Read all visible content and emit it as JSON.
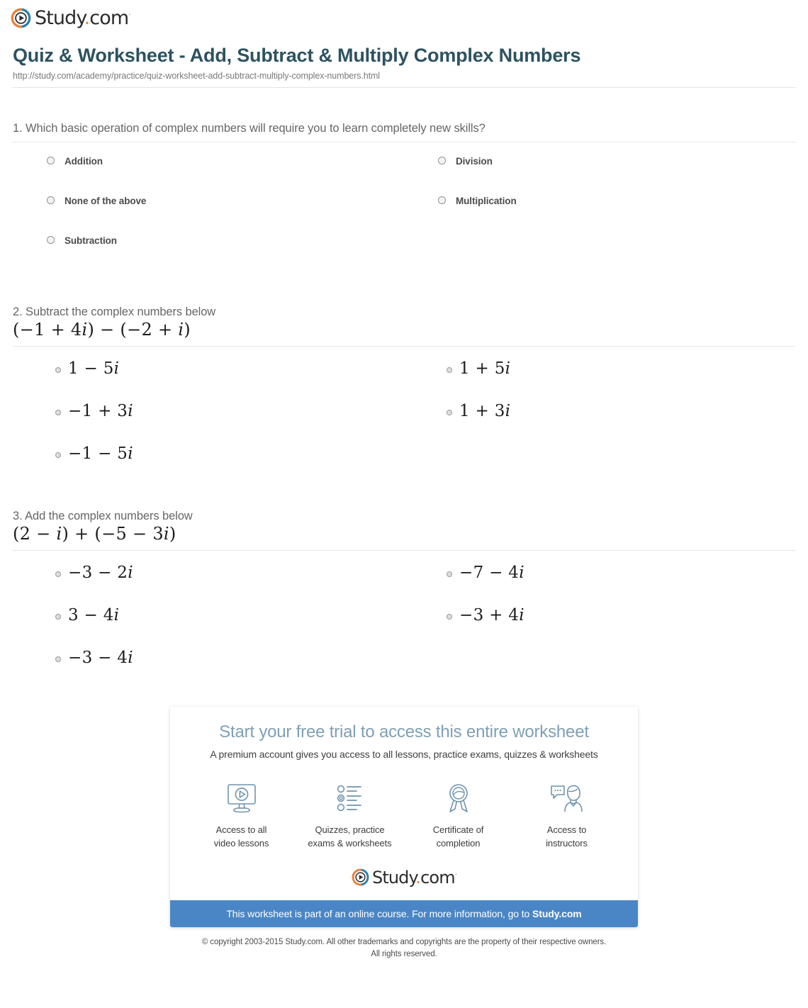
{
  "brand": {
    "name": "Study.com",
    "name_main": "Study",
    "name_dot": ".",
    "name_tld": "com",
    "trademark": "·",
    "colors": {
      "logo_orange": "#e8803a",
      "logo_blue": "#2e7fa8",
      "title_teal": "#2d5260",
      "banner_blue": "#4a86c5",
      "promo_heading": "#7fa0b5"
    }
  },
  "header": {
    "title": "Quiz & Worksheet - Add, Subtract & Multiply Complex Numbers",
    "url": "http://study.com/academy/practice/quiz-worksheet-add-subtract-multiply-complex-numbers.html"
  },
  "questions": [
    {
      "number": "1.",
      "stem": "1. Which basic operation of complex numbers will require you to learn completely new skills?",
      "math": "",
      "style": "text",
      "left_options": [
        "Addition",
        "None of the above",
        "Subtraction"
      ],
      "right_options": [
        "Division",
        "Multiplication"
      ]
    },
    {
      "number": "2.",
      "stem": "2. Subtract the complex numbers below",
      "math": "(−1 + 4i) − (−2 + i)",
      "math_parts": [
        "(−1 + 4",
        "i",
        ") − (−2 + ",
        "i",
        ")"
      ],
      "style": "math",
      "left_options": [
        "1 − 5i",
        "−1 + 3i",
        "−1 − 5i"
      ],
      "right_options": [
        "1 + 5i",
        "1 + 3i"
      ]
    },
    {
      "number": "3.",
      "stem": "3. Add the complex numbers below",
      "math": "(2 − i) + (−5 − 3i)",
      "math_parts": [
        "(2 − ",
        "i",
        ") + (−5 − 3",
        "i",
        ")"
      ],
      "style": "math",
      "left_options": [
        "−3 − 2i",
        "3 − 4i",
        "−3 − 4i"
      ],
      "right_options": [
        "−7 − 4i",
        "−3 + 4i"
      ]
    }
  ],
  "promo": {
    "title": "Start your free trial to access this entire worksheet",
    "subtitle": "A premium account gives you access to all lessons, practice exams, quizzes & worksheets",
    "features": [
      {
        "icon": "monitor-play-icon",
        "label_line1": "Access to all",
        "label_line2": "video lessons"
      },
      {
        "icon": "quiz-list-icon",
        "label_line1": "Quizzes, practice",
        "label_line2": "exams & worksheets"
      },
      {
        "icon": "award-ribbon-icon",
        "label_line1": "Certificate of",
        "label_line2": "completion"
      },
      {
        "icon": "instructor-chat-icon",
        "label_line1": "Access to",
        "label_line2": "instructors"
      }
    ],
    "banner_text_prefix": "This worksheet is part of an online course. For more information, go to ",
    "banner_link": "Study.com"
  },
  "footer": {
    "copyright_line1": "© copyright 2003-2015 Study.com. All other trademarks and copyrights are the property of their respective owners.",
    "copyright_line2": "All rights reserved."
  }
}
